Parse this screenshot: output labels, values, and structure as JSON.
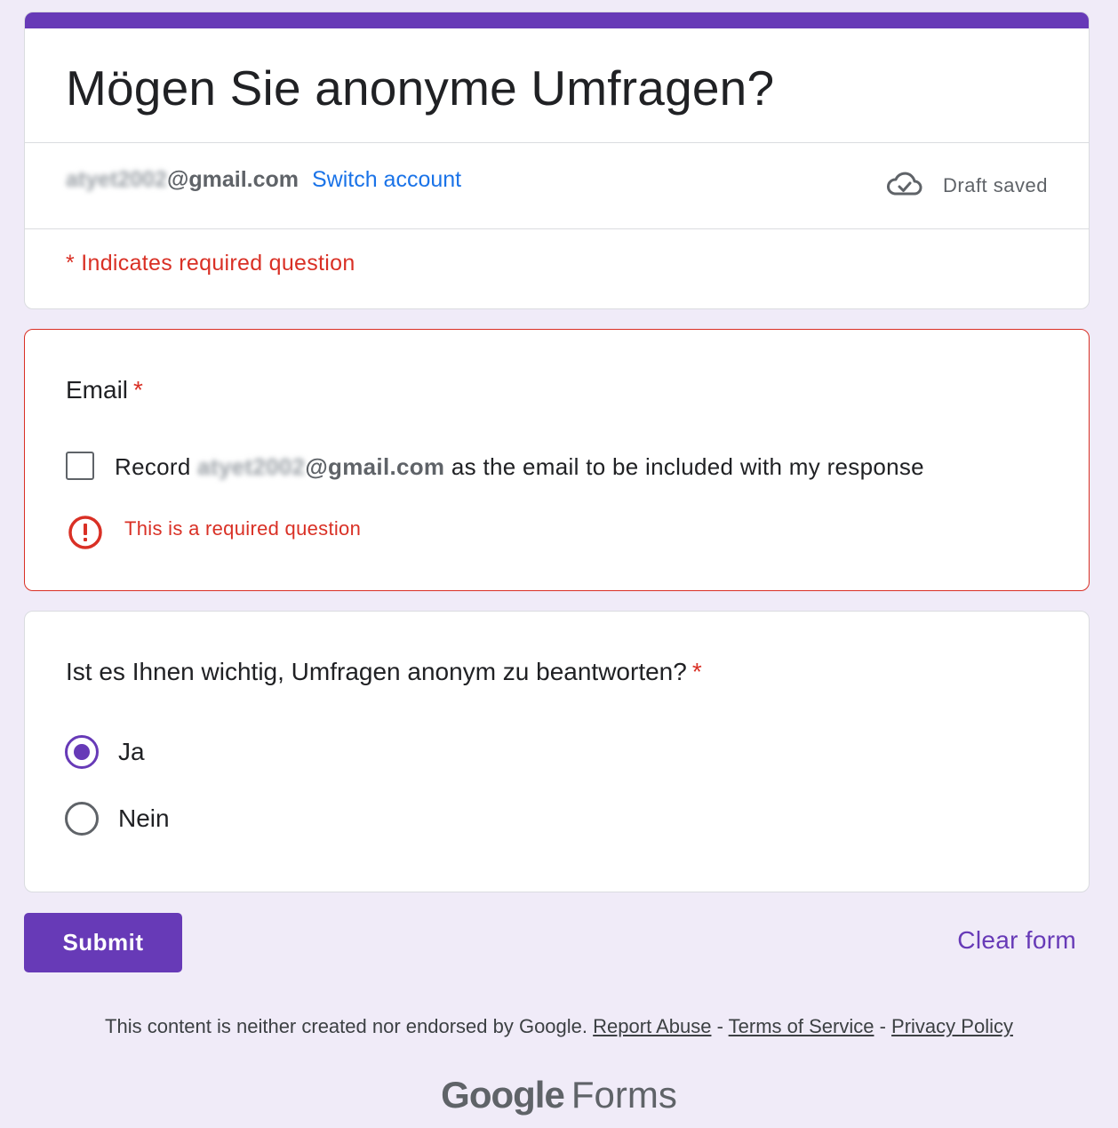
{
  "colors": {
    "accent": "#673ab7",
    "error": "#d93025",
    "link": "#1a73e8",
    "background": "#f0ebf8"
  },
  "header": {
    "title": "Mögen Sie anonyme Umfragen?",
    "account_name_blurred": "atyet2002",
    "account_email": "@gmail.com",
    "switch_account": "Switch account",
    "draft_status": "Draft saved",
    "draft_icon": "cloud-done-icon",
    "required_note": "* Indicates required question"
  },
  "email_question": {
    "title": "Email",
    "required_marker": "*",
    "checkbox_prefix": "Record",
    "checkbox_name_blurred": "atyet2002",
    "checkbox_email": "@gmail.com",
    "checkbox_suffix": "as the email to be included with my response",
    "checked": false,
    "error_icon": "error-icon",
    "error_text": "This is a required question"
  },
  "question2": {
    "title": "Ist es Ihnen wichtig, Umfragen anonym zu beantworten?",
    "required_marker": "*",
    "options": [
      {
        "label": "Ja",
        "selected": true
      },
      {
        "label": "Nein",
        "selected": false
      }
    ]
  },
  "actions": {
    "submit": "Submit",
    "clear": "Clear form"
  },
  "footer": {
    "disclaimer": "This content is neither created nor endorsed by Google.",
    "report_abuse": "Report Abuse",
    "separator": "-",
    "terms": "Terms of Service",
    "privacy": "Privacy Policy",
    "brand_google": "Google",
    "brand_forms": "Forms"
  }
}
